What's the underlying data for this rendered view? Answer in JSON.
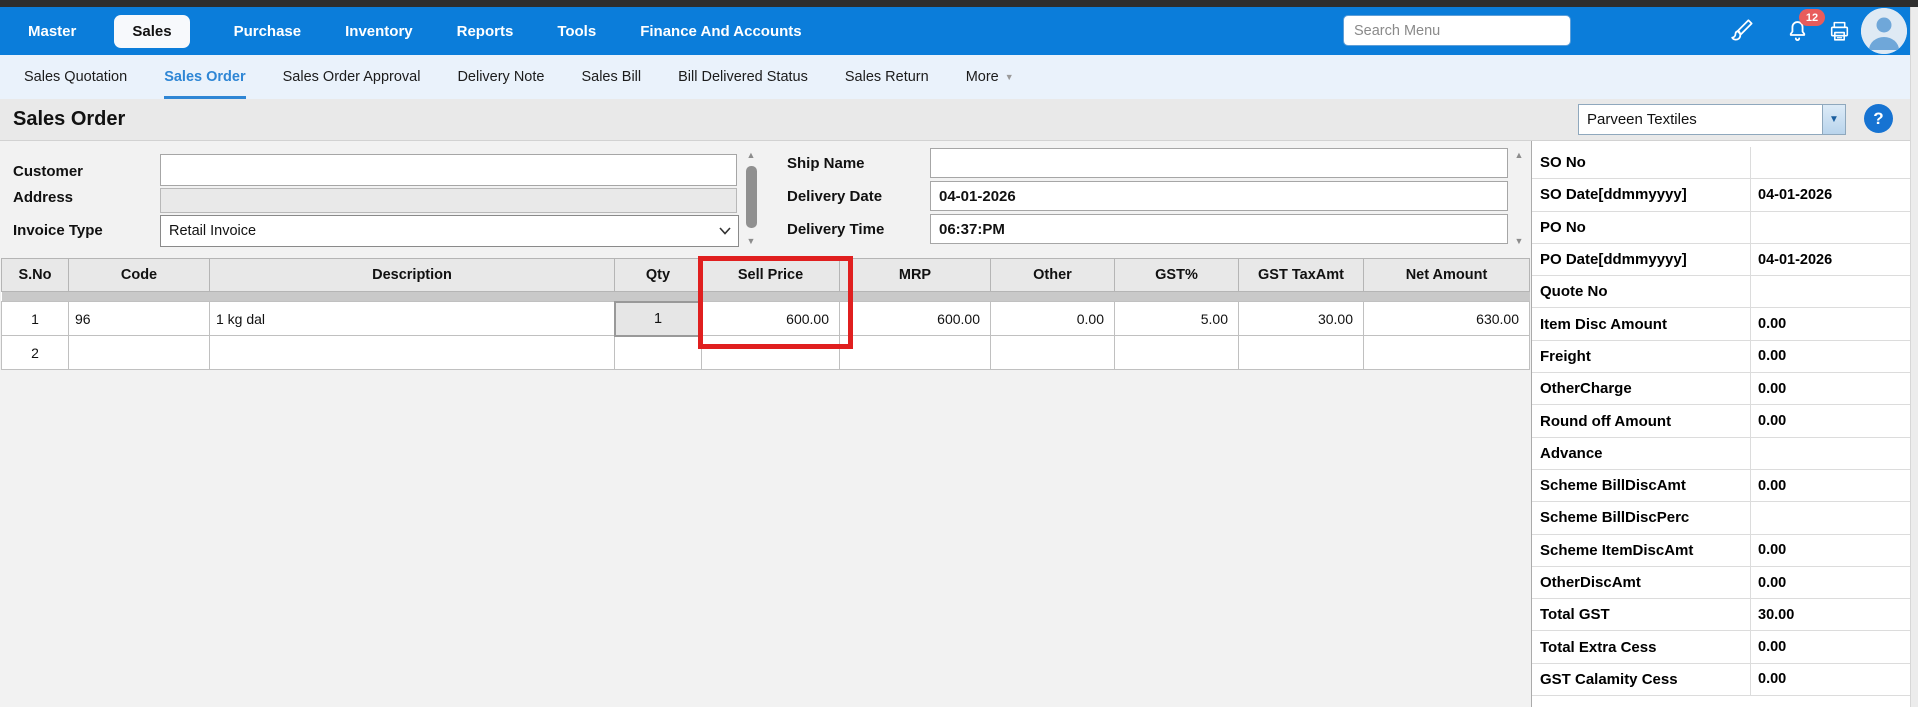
{
  "topbar": {
    "items": [
      "Master",
      "Sales",
      "Purchase",
      "Inventory",
      "Reports",
      "Tools",
      "Finance And Accounts"
    ],
    "active_item": "Sales",
    "search_placeholder": "Search Menu",
    "notification_count": "12"
  },
  "subnav": {
    "items": [
      "Sales Quotation",
      "Sales Order",
      "Sales Order Approval",
      "Delivery Note",
      "Sales Bill",
      "Bill Delivered Status",
      "Sales Return"
    ],
    "more_label": "More",
    "active_item": "Sales Order"
  },
  "page": {
    "title": "Sales Order",
    "company": "Parveen Textiles",
    "help_glyph": "?"
  },
  "form": {
    "customer_label": "Customer",
    "customer_value": "",
    "address_label": "Address",
    "address_value": "",
    "invoice_type_label": "Invoice Type",
    "invoice_type_value": "Retail Invoice",
    "ship_name_label": "Ship Name",
    "ship_name_value": "",
    "delivery_date_label": "Delivery Date",
    "delivery_date_value": "04-01-2026",
    "delivery_time_label": "Delivery Time",
    "delivery_time_value": "06:37:PM"
  },
  "table": {
    "columns": [
      "S.No",
      "Code",
      "Description",
      "Qty",
      "Sell Price",
      "MRP",
      "Other",
      "GST%",
      "GST TaxAmt",
      "Net Amount"
    ],
    "highlighted_column": "Sell Price",
    "rows": [
      {
        "sno": "1",
        "code": "96",
        "description": "1 kg dal",
        "qty": "1",
        "sell_price": "600.00",
        "mrp": "600.00",
        "other": "0.00",
        "gst_pct": "5.00",
        "gst_tax_amt": "30.00",
        "net_amount": "630.00"
      },
      {
        "sno": "2",
        "code": "",
        "description": "",
        "qty": "",
        "sell_price": "",
        "mrp": "",
        "other": "",
        "gst_pct": "",
        "gst_tax_amt": "",
        "net_amount": ""
      }
    ]
  },
  "summary": {
    "rows": [
      {
        "label": "SO No",
        "value": ""
      },
      {
        "label": "SO Date[ddmmyyyy]",
        "value": "04-01-2026"
      },
      {
        "label": "PO No",
        "value": ""
      },
      {
        "label": "PO Date[ddmmyyyy]",
        "value": "04-01-2026"
      },
      {
        "label": "Quote No",
        "value": ""
      },
      {
        "label": "Item Disc Amount",
        "value": "0.00"
      },
      {
        "label": "Freight",
        "value": "0.00"
      },
      {
        "label": "OtherCharge",
        "value": "0.00"
      },
      {
        "label": "Round off Amount",
        "value": "0.00"
      },
      {
        "label": "Advance",
        "value": ""
      },
      {
        "label": "Scheme BillDiscAmt",
        "value": "0.00"
      },
      {
        "label": "Scheme BillDiscPerc",
        "value": ""
      },
      {
        "label": "Scheme ItemDiscAmt",
        "value": "0.00"
      },
      {
        "label": "OtherDiscAmt",
        "value": "0.00"
      },
      {
        "label": "Total GST",
        "value": "30.00"
      },
      {
        "label": "Total Extra Cess",
        "value": "0.00"
      },
      {
        "label": "GST Calamity Cess",
        "value": "0.00"
      }
    ]
  },
  "colors": {
    "navbar_blue": "#0b7dda",
    "active_link_blue": "#2e86d5",
    "highlight_red": "#e01f1f",
    "badge_red": "#e85c5c",
    "help_blue": "#1673d2"
  }
}
